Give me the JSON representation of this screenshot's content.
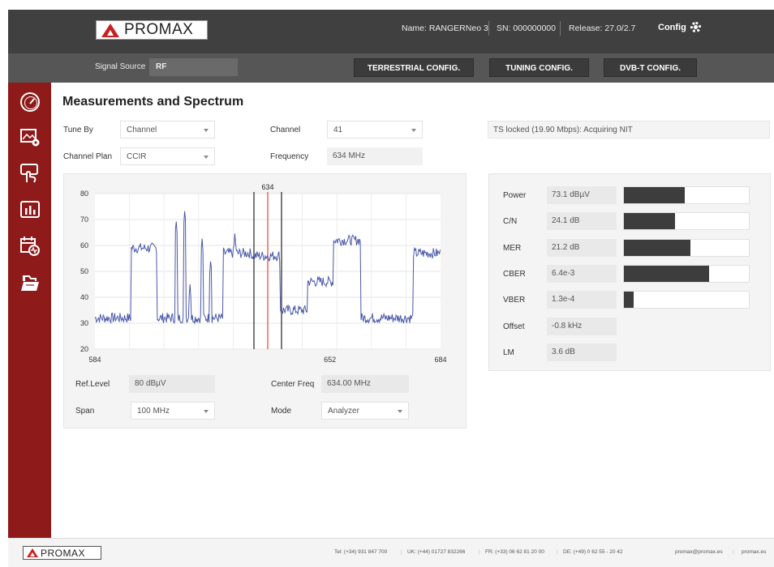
{
  "header": {
    "brand": "PROMAX",
    "name": "Name: RANGERNeo 3",
    "sn": "SN: 000000000",
    "release": "Release: 27.0/2.7",
    "config": "Config",
    "icons": [
      "gear-icon"
    ],
    "colors": {
      "bar": "#404040",
      "brand_red": "#c8201f"
    }
  },
  "subbar": {
    "signal_source_label": "Signal Source",
    "signal_source_value": "RF",
    "buttons": [
      "TERRESTRIAL CONFIG.",
      "TUNING CONFIG.",
      "DVB-T CONFIG."
    ]
  },
  "sidebar": {
    "color": "#8e1a1a",
    "icons": [
      "gauge-icon",
      "image-settings-icon",
      "touch-tool-icon",
      "bar-graph-icon",
      "calendar-signal-icon",
      "folder-icon"
    ]
  },
  "main": {
    "title": "Measurements and Spectrum",
    "tune_by_label": "Tune By",
    "tune_by_value": "Channel",
    "channel_label": "Channel",
    "channel_value": "41",
    "channel_plan_label": "Channel Plan",
    "channel_plan_value": "CCIR",
    "frequency_label": "Frequency",
    "frequency_value": "634 MHz",
    "status": "TS locked (19.90 Mbps): Acquiring NIT"
  },
  "spectrum": {
    "marker_label": "634",
    "y_ticks": [
      "80",
      "70",
      "60",
      "50",
      "40",
      "30",
      "20"
    ],
    "x_ticks": [
      "584",
      "652",
      "684"
    ],
    "ref_level_label": "Ref.Level",
    "ref_level_value": "80 dBµV",
    "center_freq_label": "Center Freq",
    "center_freq_value": "634.00 MHz",
    "span_label": "Span",
    "span_value": "100 MHz",
    "mode_label": "Mode",
    "mode_value": "Analyzer"
  },
  "measurements": [
    {
      "label": "Power",
      "value": "73.1 dBµV",
      "level": 0.49
    },
    {
      "label": "C/N",
      "value": "24.1 dB",
      "level": 0.41
    },
    {
      "label": "MER",
      "value": "21.2 dB",
      "level": 0.53
    },
    {
      "label": "CBER",
      "value": "6.4e-3",
      "level": 0.68
    },
    {
      "label": "VBER",
      "value": "1.3e-4",
      "level": 0.08
    },
    {
      "label": "Offset",
      "value": "-0.8 kHz"
    },
    {
      "label": "LM",
      "value": "3.6 dB"
    }
  ],
  "footer": {
    "brand": "PROMAX",
    "tel": "Tel: (+34) 931 847 700",
    "uk": "UK: (+44) 01727 832266",
    "fr": "FR: (+33) 06 62 81 20 00",
    "de": "DE: (+49) 0 62 55 - 20 42",
    "email": "promax@promax.es",
    "web": "promax.es"
  }
}
